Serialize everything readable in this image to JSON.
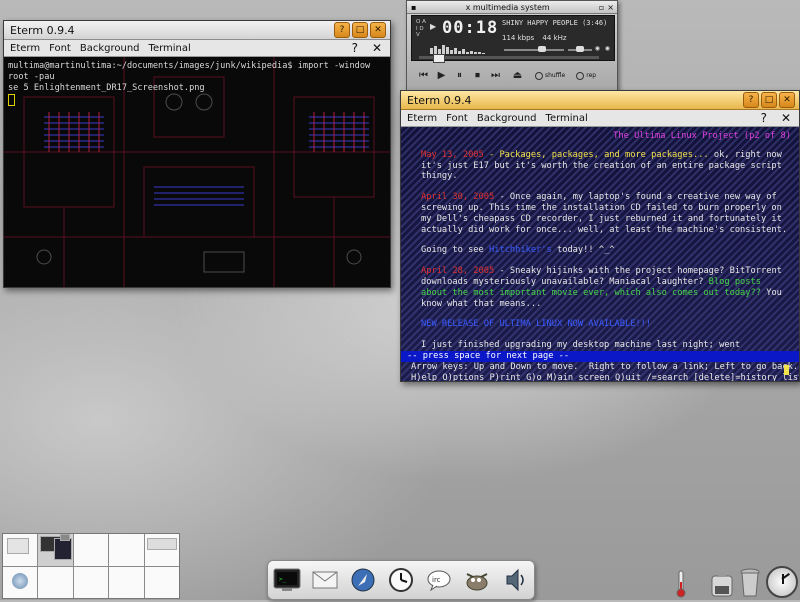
{
  "terminal1": {
    "title": "Eterm 0.9.4",
    "menu": [
      "Eterm",
      "Font",
      "Background",
      "Terminal"
    ],
    "title_buttons": [
      "?",
      "□",
      "✕"
    ],
    "menu_right": [
      "?",
      "✕"
    ],
    "prompt_line1": "multima@martinultima:~/documents/images/junk/wikipedia$ import -window root -pau",
    "prompt_line2": "se 5 Enlightenment_DR17_Screenshot.png"
  },
  "terminal2": {
    "title": "Eterm 0.9.4",
    "menu": [
      "Eterm",
      "Font",
      "Background",
      "Terminal"
    ],
    "title_buttons": [
      "?",
      "□",
      "✕"
    ],
    "menu_right": [
      "?",
      "✕"
    ],
    "page_header": "The Ultima Linux Project (p2 of 8)",
    "entry1_date": "May 13, 2005",
    "entry1_title": " - Packages, packages, and more packages...",
    "entry1_text1": " ok, right now",
    "entry1_text2": "it's just E17 but it's worth the creation of an entire package script",
    "entry1_text3": "thingy.",
    "entry2_date": "April 30, 2005",
    "entry2_text1": " - Once again, my laptop's found a creative new way of",
    "entry2_text2": "screwing up. This time the installation CD failed to burn properly on",
    "entry2_text3": "my Dell's cheapass CD recorder, I just reburned it and fortunately it",
    "entry2_text4": "actually did work for once... well, at least the machine's consistent.",
    "going_pre": "Going to see ",
    "going_link": "Hitchhiker's",
    "going_post": " today!! ^_^",
    "entry3_date": "April 28, 2005",
    "entry3_text1": " - Sneaky hijinks with the project homepage? BitTorrent",
    "entry3_text2_pre": "downloads mysteriously unavailable? Maniacal laughter? ",
    "entry3_text2_link": "Blog posts",
    "entry3_text3_link": "about the most important movie ever, which also comes out today??",
    "entry3_text3_post": " You",
    "entry3_text4": "know what that means...",
    "release_link": "NEW RELEASE OF ULTIMA LINUX NOW AVAILABLE!!!",
    "desktop_line": "I just finished upgrading my desktop machine last night; went",
    "status": "-- press space for next page --",
    "help1": "Arrow keys: Up and Down to move.  Right to follow a link; Left to go back.",
    "help2": "H)elp O)ptions P)rint G)o M)ain screen Q)uit /=search [delete]=history list"
  },
  "xmms": {
    "title": "x multimedia system",
    "time": "00:18",
    "song": "SHINY HAPPY PEOPLE (3:46)",
    "bitrate": "114 kbps",
    "samplerate": "44 kHz",
    "side_letters": "O A I D V",
    "buttons": [
      "⏮",
      "▶",
      "⏸",
      "⏹",
      "⏭",
      "⏏"
    ],
    "shuffle": "shuffle",
    "repeat": "rep",
    "seek_fraction": 0.08
  },
  "pager": {
    "active_index": 1
  },
  "dock": {
    "icons": [
      "terminal-icon",
      "mail-icon",
      "browser-icon",
      "clock-icon",
      "irc-icon",
      "gimp-icon",
      "audio-icon"
    ],
    "irc_label": "irc"
  },
  "colors": {
    "lynx_date": "#e03030",
    "lynx_title": "#f1e14a",
    "lynx_link": "#47d547",
    "lynx_status_bg": "#0a18c8",
    "eterm2_titlebar": "#e7b74a"
  }
}
